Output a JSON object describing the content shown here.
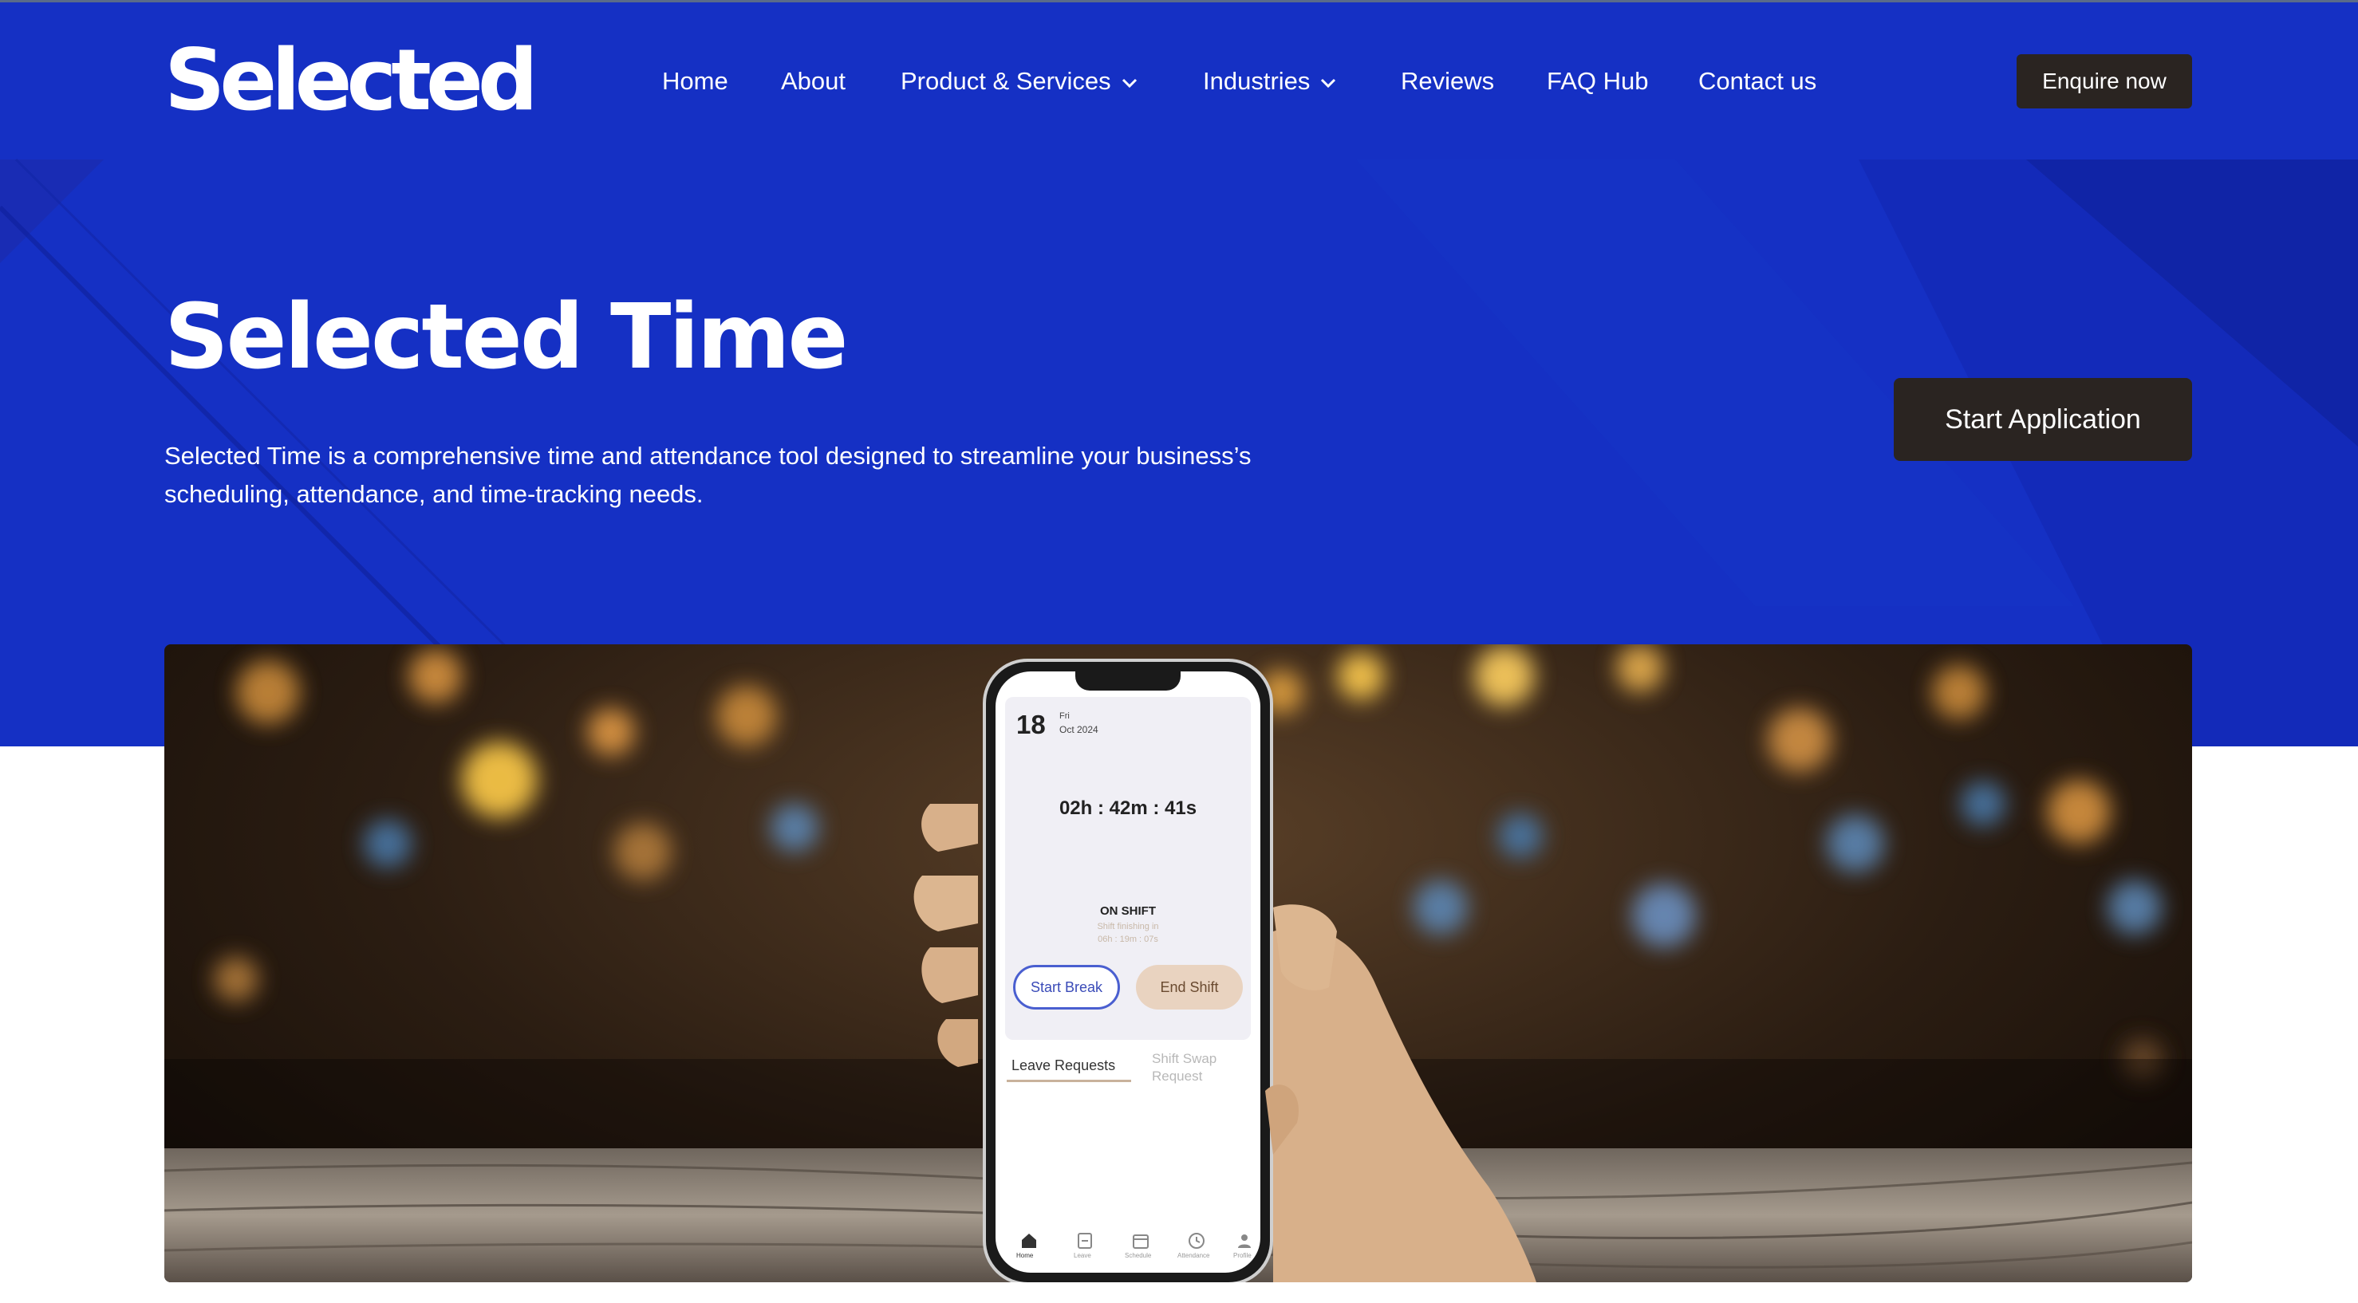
{
  "brand": {
    "logo": "Selected"
  },
  "nav": {
    "home": "Home",
    "about": "About",
    "products": "Product & Services",
    "industries": "Industries",
    "reviews": "Reviews",
    "faq": "FAQ Hub",
    "contact": "Contact us"
  },
  "header": {
    "cta": "Enquire now"
  },
  "hero": {
    "title": "Selected Time",
    "description": "Selected Time is a comprehensive time and attendance tool designed to streamline your business’s scheduling, attendance, and time-tracking needs.",
    "cta": "Start Application"
  },
  "phone_app": {
    "day": "18",
    "weekday": "Fri",
    "month": "Oct 2024",
    "timer": "02h : 42m : 41s",
    "status": "ON SHIFT",
    "shift_note": "Shift finishing in",
    "shift_remaining": "06h : 19m : 07s",
    "start_break": "Start Break",
    "end_shift": "End Shift",
    "tab_leave": "Leave Requests",
    "tab_swap_1": "Shift Swap",
    "tab_swap_2": "Request",
    "bottom_nav": [
      "Home",
      "Leave",
      "Schedule",
      "Attendance",
      "Profile"
    ]
  },
  "colors": {
    "hero_blue": "#1530c4",
    "button_dark": "#2a2421",
    "end_shift_bg": "#e9d3c0",
    "start_break_border": "#4a5fd0"
  },
  "icons": [
    "chevron-down-icon",
    "home-icon",
    "leave-icon",
    "calendar-icon",
    "clock-icon",
    "user-icon"
  ]
}
